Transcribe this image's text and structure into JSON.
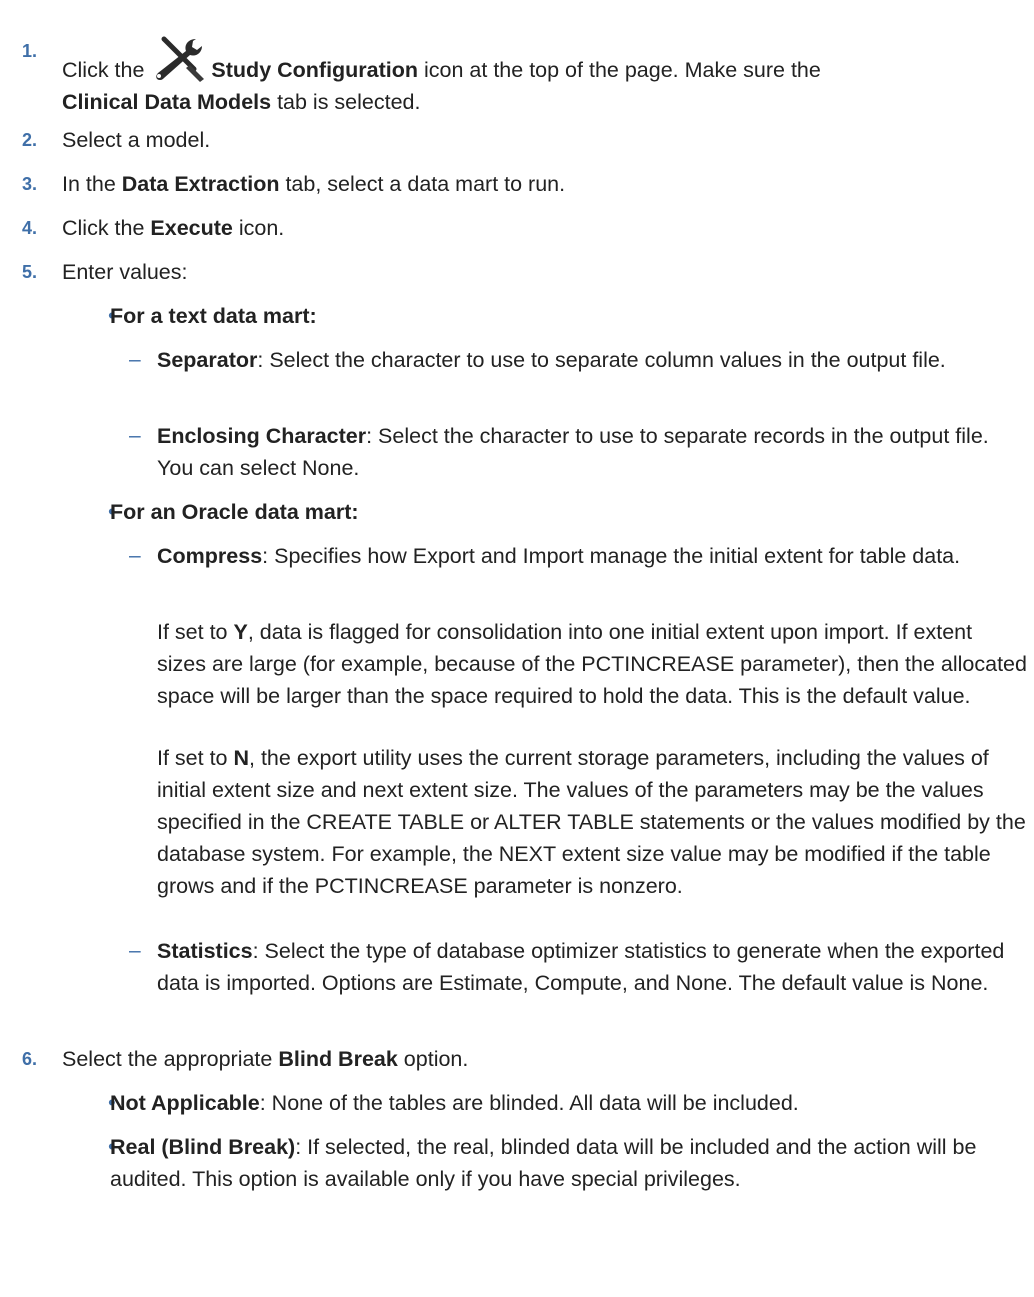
{
  "steps": [
    {
      "number": "1.",
      "parts": [
        "Click the ",
        "Study Configuration",
        " icon at the top of the page. Make sure the ",
        "Clinical Data Models",
        " tab is selected."
      ]
    },
    {
      "number": "2.",
      "text": "Select a model."
    },
    {
      "number": "3.",
      "parts": [
        "In the ",
        "Data Extraction",
        " tab, select a data mart to run."
      ]
    },
    {
      "number": "4.",
      "parts": [
        "Click the ",
        "Execute",
        " icon."
      ]
    },
    {
      "number": "5.",
      "text": "Enter values:",
      "text_mart": {
        "heading": "For a text data mart:",
        "items": [
          {
            "term": "Separator",
            "desc": ": Select the character to use to separate column values in the output file."
          },
          {
            "term": "Enclosing Character",
            "desc": ": Select the character to use to separate records in the output file. You can select None."
          }
        ]
      },
      "oracle_mart": {
        "heading": "For an Oracle data mart:",
        "compress": {
          "term": "Compress",
          "desc": ": Specifies how Export and Import manage the initial extent for table data.",
          "para_y": {
            "pre": "If set to ",
            "flag": "Y",
            "post": ", data is flagged for consolidation into one initial extent upon import. If extent sizes are large (for example, because of the PCTINCREASE parameter), then the allocated space will be larger than the space required to hold the data. This is the default value."
          },
          "para_n": {
            "pre": "If set to ",
            "flag": "N",
            "post": ", the export utility uses the current storage parameters, including the values of initial extent size and next extent size. The values of the parameters may be the values specified in the CREATE TABLE or ALTER TABLE statements or the values modified by the database system. For example, the NEXT extent size value may be modified if the table grows and if the PCTINCREASE parameter is nonzero."
          }
        },
        "statistics": {
          "term": "Statistics",
          "desc": ": Select the type of database optimizer statistics to generate when the exported data is imported. Options are Estimate, Compute, and None. The default value is None."
        }
      }
    },
    {
      "number": "6.",
      "parts": [
        "Select the appropriate ",
        "Blind Break",
        " option."
      ],
      "options": [
        {
          "term": "Not Applicable",
          "desc": ": None of the tables are blinded. All data will be included."
        },
        {
          "term": "Real (Blind Break)",
          "desc": ": If selected, the real, blinded data will be included and the action will be audited. This option is available only if you have special privileges."
        }
      ]
    }
  ],
  "marks": {
    "bullet": "•",
    "dash": "–"
  },
  "icons": {
    "study_configuration": "tools-wrench-screwdriver-icon"
  },
  "colors": {
    "number_accent": "#3f6fa8",
    "text": "#222222",
    "icon_dark": "#2b2b2b"
  }
}
